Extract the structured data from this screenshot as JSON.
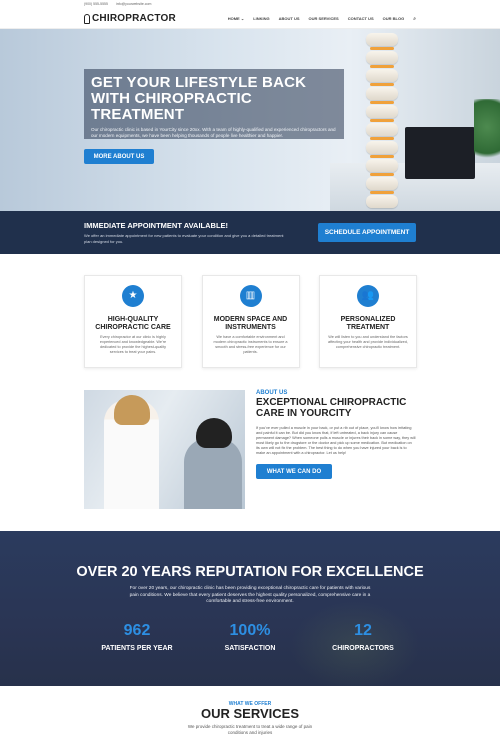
{
  "topbar": {
    "phone": "(900) 555-5555",
    "email": "info@yourwebsite.com"
  },
  "header": {
    "logo_text": "CHIROPRACTOR",
    "nav": [
      "HOME",
      "LINKING",
      "ABOUT US",
      "OUR SERVICES",
      "CONTACT US",
      "OUR BLOG"
    ],
    "home_chevron": "⌄"
  },
  "hero": {
    "title": "GET YOUR LIFESTYLE BACK WITH CHIROPRACTIC TREATMENT",
    "body": "Our chiropractic clinic is based in YourCity since 20xx. With a team of highly-qualified and experienced chiropractors and our modern equipments, we have been helping thousands of people live healthier and happier.",
    "button": "MORE ABOUT US"
  },
  "appointment": {
    "title": "IMMEDIATE APPOINTMENT AVAILABLE!",
    "body": "We offer an immediate appointment for new patients to evaluate your condition and give you a detailed treatment plan designed for you.",
    "button": "SCHEDULE APPOINTMENT"
  },
  "features": [
    {
      "icon": "star-icon",
      "glyph": "★",
      "title": "HIGH-QUALITY CHIROPRACTIC CARE",
      "body": "Every chiropractor at our clinic is highly experienced and knowledgeable. We're dedicated to provide the highest-quality services to treat your pains."
    },
    {
      "icon": "building-icon",
      "glyph": "▥",
      "title": "MODERN SPACE AND INSTRUMENTS",
      "body": "We have a comfortable environment and modern chiropractic instruments to ensure a smooth and stress-free experience for our patients."
    },
    {
      "icon": "people-icon",
      "glyph": "👥",
      "title": "PERSONALIZED TREATMENT",
      "body": "We will listen to you and understand the factors affecting your health and provide individualized, comprehensive chiropractic treatment."
    }
  ],
  "about": {
    "eyebrow": "ABOUT US",
    "title": "EXCEPTIONAL CHIROPRACTIC CARE IN YOURCITY",
    "body": "If you've ever pulled a muscle in your back, or put a rib out of place, you'll know how irritating and painful it can be. But did you know that, if left untreated, a back injury can cause permanent damage? When someone pulls a muscle or injures their back in some way, they will most likely go to the drugstore or the doctor and pick up some medication. But medication on its own will not fix the problem. The best thing to do when you have injured your back is to make an appointment with a chiropractor. Let us help!",
    "button": "WHAT WE CAN DO"
  },
  "stats": {
    "title": "OVER 20 YEARS REPUTATION FOR EXCELLENCE",
    "body": "For over 20 years, our chiropractic clinic has been providing exceptional chiropractic care for patients with various pain conditions. We believe that every patient deserves the highest quality personalized, comprehensive care in a comfortable and stress-free environment.",
    "items": [
      {
        "number": "962",
        "label": "PATIENTS PER YEAR"
      },
      {
        "number": "100%",
        "label": "SATISFACTION"
      },
      {
        "number": "12",
        "label": "CHIROPRACTORS"
      }
    ]
  },
  "services": {
    "eyebrow": "WHAT WE OFFER",
    "title": "OUR SERVICES",
    "body": "We provide chiropractic treatment to treat a wide range of pain conditions and injuries"
  },
  "colors": {
    "accent": "#1f7fd1",
    "navy": "#20304c",
    "stats_bg": "#2b3b5e"
  }
}
